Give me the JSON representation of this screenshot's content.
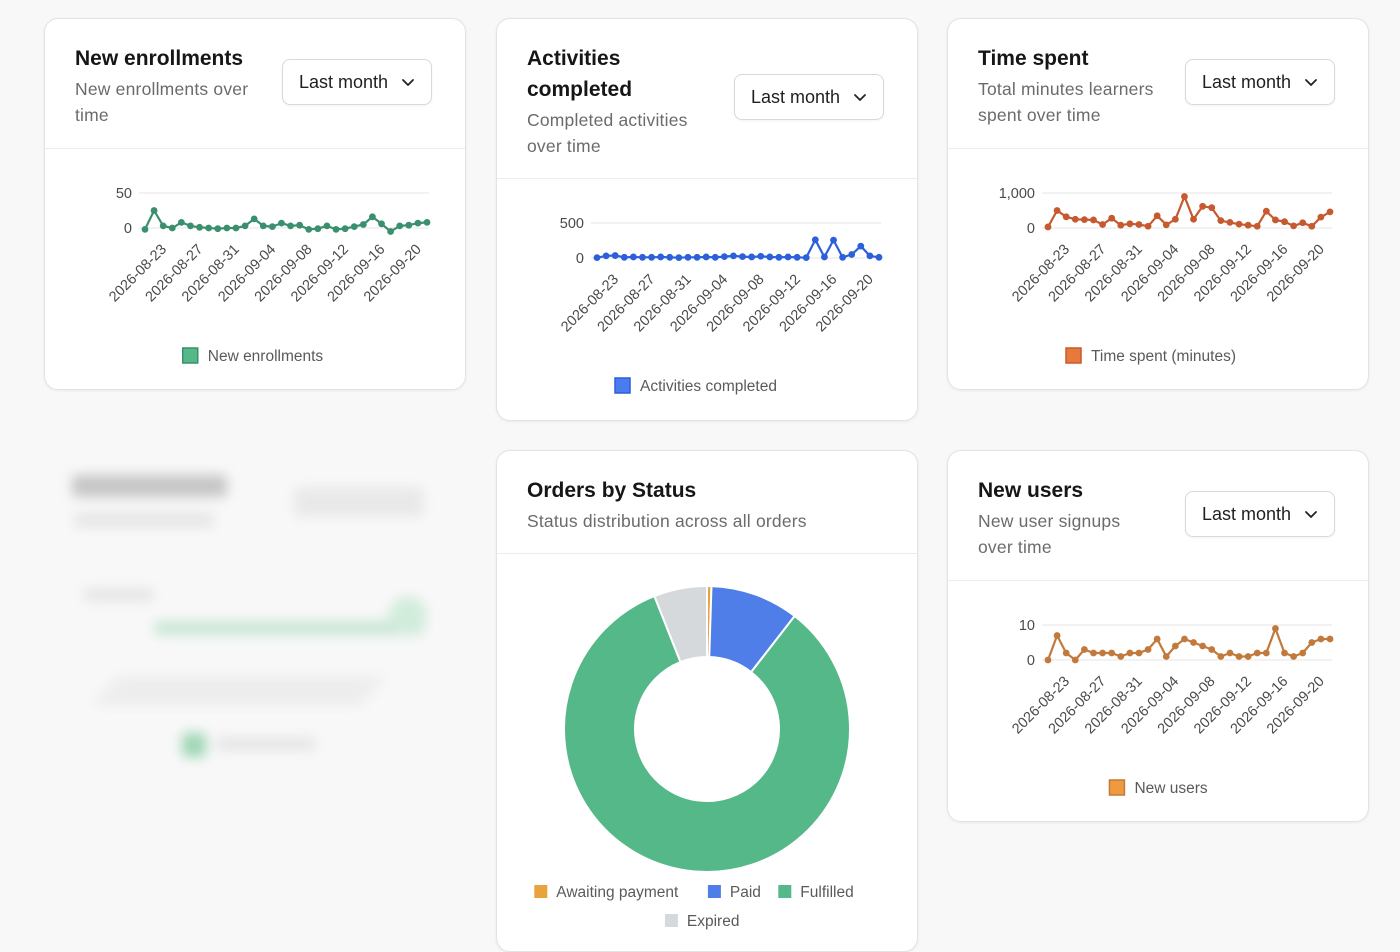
{
  "dates": [
    "2026-08-21",
    "2026-08-22",
    "2026-08-23",
    "2026-08-24",
    "2026-08-25",
    "2026-08-26",
    "2026-08-27",
    "2026-08-28",
    "2026-08-29",
    "2026-08-30",
    "2026-08-31",
    "2026-09-01",
    "2026-09-02",
    "2026-09-03",
    "2026-09-04",
    "2026-09-05",
    "2026-09-06",
    "2026-09-07",
    "2026-09-08",
    "2026-09-09",
    "2026-09-10",
    "2026-09-11",
    "2026-09-12",
    "2026-09-13",
    "2026-09-14",
    "2026-09-15",
    "2026-09-16",
    "2026-09-17",
    "2026-09-18",
    "2026-09-19",
    "2026-09-20",
    "2026-09-21"
  ],
  "cards": {
    "enrollments": {
      "title": "New enrollments",
      "subtitle": [
        "New enrollments over",
        "time"
      ],
      "range": "Last month"
    },
    "activities": {
      "title": [
        "Activities",
        "completed"
      ],
      "subtitle": [
        "Completed activities",
        "over time"
      ],
      "range": "Last month"
    },
    "time_spent": {
      "title": "Time spent",
      "subtitle": [
        "Total minutes learners",
        "spent over time"
      ],
      "range": "Last month"
    },
    "orders": {
      "title": "Orders by Status",
      "subtitle": "Status distribution across all orders"
    },
    "new_users": {
      "title": "New users",
      "subtitle": [
        "New user signups",
        "over time"
      ],
      "range": "Last month"
    }
  },
  "icons": {
    "dropdown": "chevron-down-icon"
  },
  "chart_data": [
    {
      "id": "enrollments",
      "type": "line",
      "color": "#3a8f6e",
      "legend_color": "#55b888",
      "x": [
        "2026-08-21",
        "2026-08-22",
        "2026-08-23",
        "2026-08-24",
        "2026-08-25",
        "2026-08-26",
        "2026-08-27",
        "2026-08-28",
        "2026-08-29",
        "2026-08-30",
        "2026-08-31",
        "2026-09-01",
        "2026-09-02",
        "2026-09-03",
        "2026-09-04",
        "2026-09-05",
        "2026-09-06",
        "2026-09-07",
        "2026-09-08",
        "2026-09-09",
        "2026-09-10",
        "2026-09-11",
        "2026-09-12",
        "2026-09-13",
        "2026-09-14",
        "2026-09-15",
        "2026-09-16",
        "2026-09-17",
        "2026-09-18",
        "2026-09-19",
        "2026-09-20",
        "2026-09-21"
      ],
      "xticks": [
        "2026-08-23",
        "2026-08-27",
        "2026-08-31",
        "2026-09-04",
        "2026-09-08",
        "2026-09-12",
        "2026-09-16",
        "2026-09-20"
      ],
      "ylim": [
        0,
        50
      ],
      "yticks": [
        "0",
        "50"
      ],
      "series": [
        {
          "name": "New enrollments",
          "values": [
            -2,
            25,
            3,
            0,
            8,
            3,
            1,
            0,
            -1,
            0,
            0,
            3,
            13,
            3,
            2,
            7,
            3,
            4,
            -2,
            -1,
            3,
            -2,
            -1,
            2,
            5,
            16,
            6,
            -5,
            3,
            4,
            7,
            8
          ]
        }
      ]
    },
    {
      "id": "activities",
      "type": "line",
      "color": "#2c5fdc",
      "legend_color": "#4a7cf0",
      "x": [
        "2026-08-21",
        "2026-08-22",
        "2026-08-23",
        "2026-08-24",
        "2026-08-25",
        "2026-08-26",
        "2026-08-27",
        "2026-08-28",
        "2026-08-29",
        "2026-08-30",
        "2026-08-31",
        "2026-09-01",
        "2026-09-02",
        "2026-09-03",
        "2026-09-04",
        "2026-09-05",
        "2026-09-06",
        "2026-09-07",
        "2026-09-08",
        "2026-09-09",
        "2026-09-10",
        "2026-09-11",
        "2026-09-12",
        "2026-09-13",
        "2026-09-14",
        "2026-09-15",
        "2026-09-16",
        "2026-09-17",
        "2026-09-18",
        "2026-09-19",
        "2026-09-20",
        "2026-09-21"
      ],
      "xticks": [
        "2026-08-23",
        "2026-08-27",
        "2026-08-31",
        "2026-09-04",
        "2026-09-08",
        "2026-09-12",
        "2026-09-16",
        "2026-09-20"
      ],
      "ylim": [
        0,
        500
      ],
      "yticks": [
        "0",
        "500"
      ],
      "series": [
        {
          "name": "Activities completed",
          "values": [
            5,
            30,
            35,
            10,
            15,
            10,
            10,
            15,
            10,
            5,
            10,
            10,
            15,
            10,
            20,
            30,
            20,
            15,
            25,
            15,
            10,
            15,
            10,
            5,
            260,
            15,
            255,
            10,
            50,
            170,
            30,
            10
          ]
        }
      ]
    },
    {
      "id": "time_spent",
      "type": "line",
      "color": "#c65a2e",
      "legend_color": "#e77a3b",
      "x": [
        "2026-08-21",
        "2026-08-22",
        "2026-08-23",
        "2026-08-24",
        "2026-08-25",
        "2026-08-26",
        "2026-08-27",
        "2026-08-28",
        "2026-08-29",
        "2026-08-30",
        "2026-08-31",
        "2026-09-01",
        "2026-09-02",
        "2026-09-03",
        "2026-09-04",
        "2026-09-05",
        "2026-09-06",
        "2026-09-07",
        "2026-09-08",
        "2026-09-09",
        "2026-09-10",
        "2026-09-11",
        "2026-09-12",
        "2026-09-13",
        "2026-09-14",
        "2026-09-15",
        "2026-09-16",
        "2026-09-17",
        "2026-09-18",
        "2026-09-19",
        "2026-09-20",
        "2026-09-21"
      ],
      "xticks": [
        "2026-08-23",
        "2026-08-27",
        "2026-08-31",
        "2026-09-04",
        "2026-09-08",
        "2026-09-12",
        "2026-09-16",
        "2026-09-20"
      ],
      "ylim": [
        0,
        1000
      ],
      "yticks": [
        "0",
        "1,000"
      ],
      "series": [
        {
          "name": "Time spent (minutes)",
          "values": [
            30,
            500,
            320,
            250,
            240,
            230,
            100,
            280,
            80,
            120,
            100,
            50,
            350,
            90,
            250,
            900,
            250,
            620,
            580,
            210,
            160,
            110,
            80,
            50,
            480,
            230,
            180,
            60,
            150,
            50,
            310,
            460
          ]
        }
      ]
    },
    {
      "id": "new_users",
      "type": "line",
      "color": "#c27a3c",
      "legend_color": "#ef9a3f",
      "x": [
        "2026-08-21",
        "2026-08-22",
        "2026-08-23",
        "2026-08-24",
        "2026-08-25",
        "2026-08-26",
        "2026-08-27",
        "2026-08-28",
        "2026-08-29",
        "2026-08-30",
        "2026-08-31",
        "2026-09-01",
        "2026-09-02",
        "2026-09-03",
        "2026-09-04",
        "2026-09-05",
        "2026-09-06",
        "2026-09-07",
        "2026-09-08",
        "2026-09-09",
        "2026-09-10",
        "2026-09-11",
        "2026-09-12",
        "2026-09-13",
        "2026-09-14",
        "2026-09-15",
        "2026-09-16",
        "2026-09-17",
        "2026-09-18",
        "2026-09-19",
        "2026-09-20",
        "2026-09-21"
      ],
      "xticks": [
        "2026-08-23",
        "2026-08-27",
        "2026-08-31",
        "2026-09-04",
        "2026-09-08",
        "2026-09-12",
        "2026-09-16",
        "2026-09-20"
      ],
      "ylim": [
        0,
        10
      ],
      "yticks": [
        "0",
        "10"
      ],
      "series": [
        {
          "name": "New users",
          "values": [
            0,
            7,
            2,
            0,
            3,
            2,
            2,
            2,
            1,
            2,
            2,
            3,
            6,
            1,
            4,
            6,
            5,
            4,
            3,
            1,
            2,
            1,
            1,
            2,
            2,
            9,
            2,
            1,
            2,
            5,
            6,
            6
          ]
        }
      ]
    },
    {
      "id": "orders",
      "type": "pie",
      "donut": true,
      "labels": [
        "Awaiting payment",
        "Paid",
        "Fulfilled",
        "Expired"
      ],
      "values": [
        0.5,
        10,
        83.5,
        6
      ],
      "colors": [
        "#e8a33d",
        "#4f7ee8",
        "#55b888",
        "#d6d9dc"
      ],
      "legend_placement": "bottom"
    }
  ]
}
